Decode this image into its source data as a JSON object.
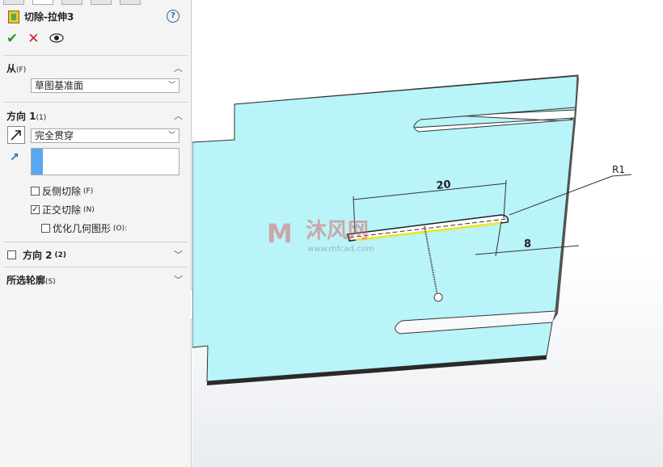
{
  "feature": {
    "title": "切除-拉伸3",
    "help": "?"
  },
  "actions": {
    "ok": "✔",
    "cancel": "✕",
    "preview": "👁"
  },
  "from": {
    "label": "从",
    "shortcut": "(F)",
    "value": "草图基准面"
  },
  "direction1": {
    "label": "方向 1",
    "shortcut": "(1)",
    "end_condition": "完全贯穿",
    "flip_side": {
      "label": "反侧切除",
      "shortcut": "(F)",
      "checked": false
    },
    "normal_cut": {
      "label": "正交切除",
      "shortcut": "(N)",
      "checked": true
    },
    "optimize": {
      "label": "优化几何图形",
      "shortcut": "(O):",
      "checked": false
    }
  },
  "direction2": {
    "label": "方向 2",
    "shortcut": "(2)",
    "checked": false
  },
  "selected_contours": {
    "label": "所选轮廓",
    "shortcut": "(S)"
  },
  "viewport": {
    "dim_length": "20",
    "dim_offset": "8",
    "dim_radius": "R1",
    "watermark_cn": "沐风网",
    "watermark_url": "www.mfcad.com",
    "plate_color": "#b8f4f8",
    "accent_color": "#5aa7f0"
  }
}
